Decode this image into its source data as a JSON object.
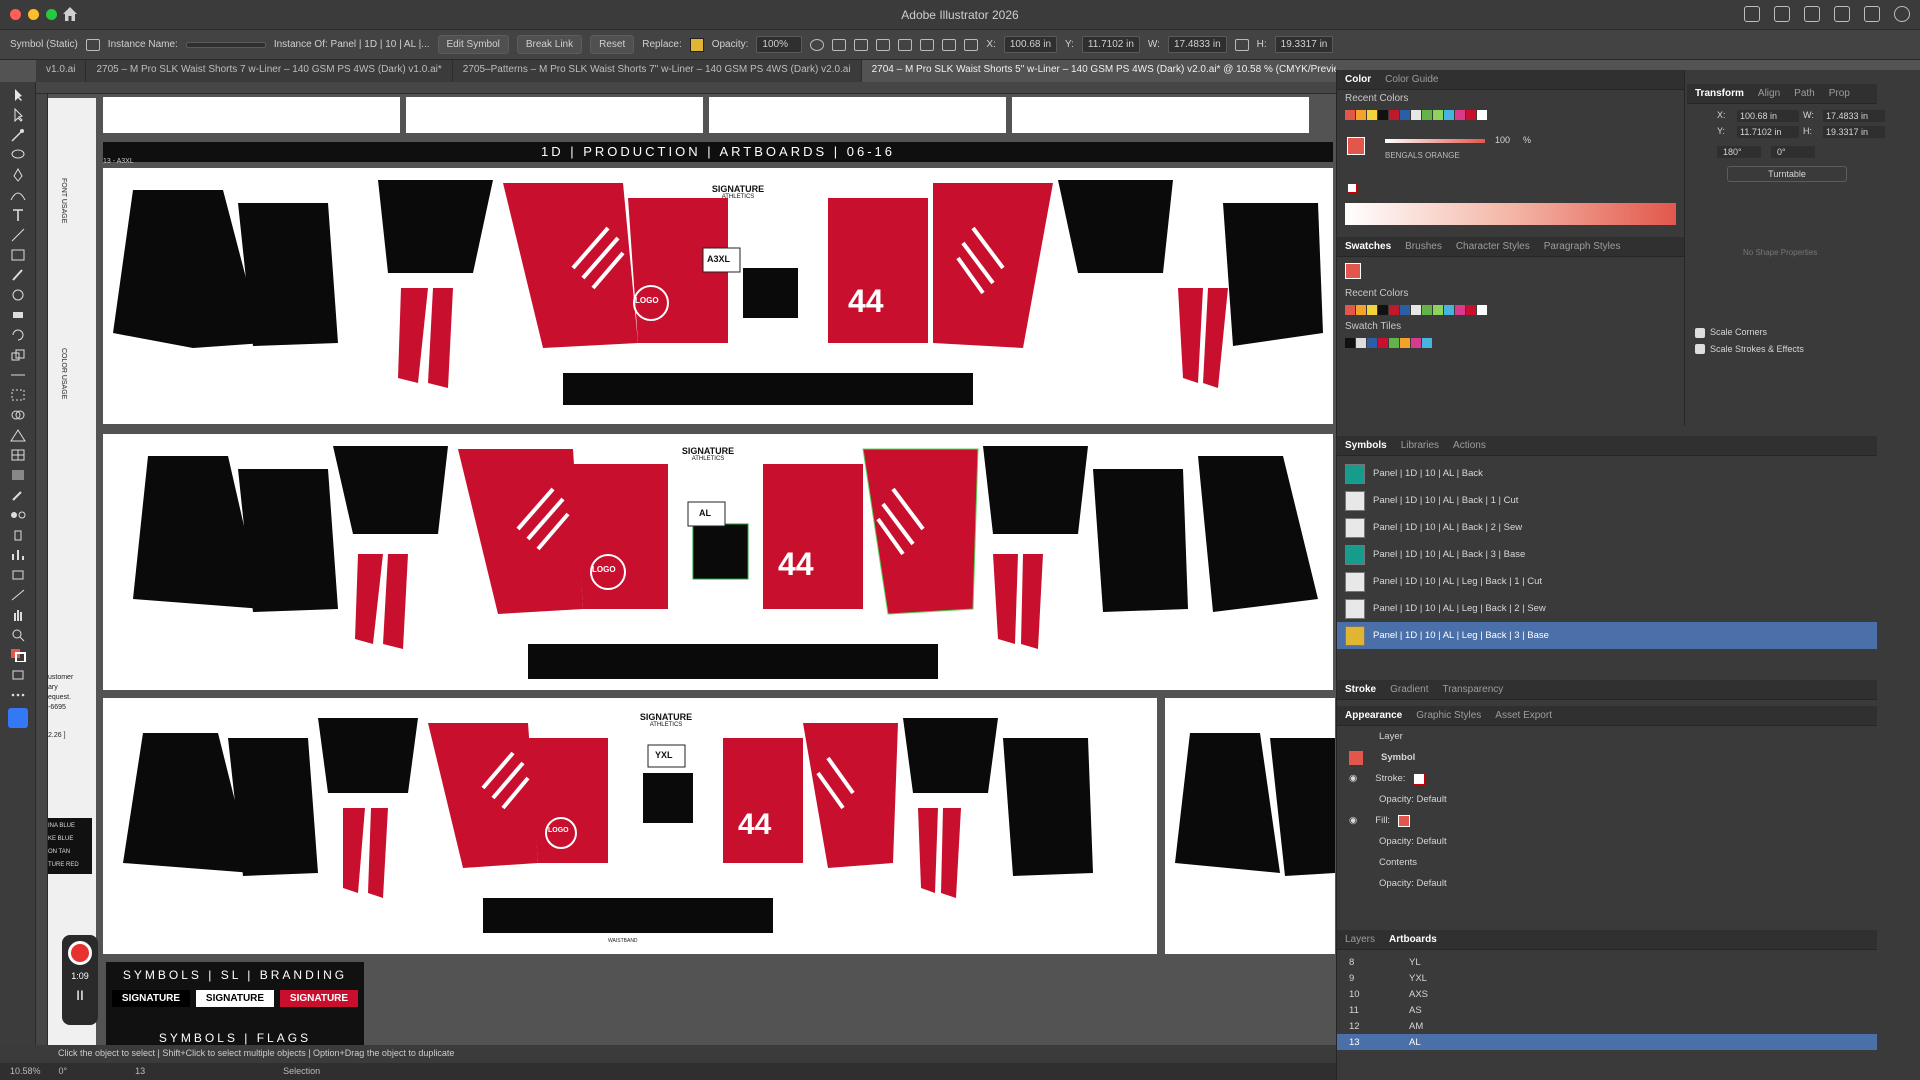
{
  "app": {
    "title": "Adobe Illustrator 2026"
  },
  "control": {
    "symbol_type": "Symbol (Static)",
    "instance_name_label": "Instance Name:",
    "instance_of": "Instance Of: Panel | 1D | 10 | AL |...",
    "edit_symbol": "Edit Symbol",
    "break_link": "Break Link",
    "reset": "Reset",
    "replace_label": "Replace:",
    "opacity_label": "Opacity:",
    "opacity_value": "100%",
    "x_label": "X:",
    "x_value": "100.68 in",
    "y_label": "Y:",
    "y_value": "11.7102 in",
    "w_label": "W:",
    "w_value": "17.4833 in",
    "h_label": "H:",
    "h_value": "19.3317 in"
  },
  "tabs": [
    {
      "label": "v1.0.ai"
    },
    {
      "label": "2705 – M Pro SLK Waist Shorts 7 w-Liner – 140 GSM PS 4WS (Dark) v1.0.ai*"
    },
    {
      "label": "2705–Patterns – M Pro SLK Waist Shorts 7\" w-Liner – 140 GSM PS 4WS (Dark) v2.0.ai"
    },
    {
      "label": "2704 – M Pro SLK Waist Shorts 5\" w-Liner – 140 GSM PS 4WS (Dark) v2.0.ai* @ 10.58 % (CMYK/Preview)"
    }
  ],
  "canvas": {
    "banner": "1D | PRODUCTION | ARTBOARDS | 06-16",
    "artboard_label": "13 - A3XL",
    "side_labels": [
      "FONT USAGE",
      "COLOR USAGE"
    ],
    "size_tags": [
      "A3XL",
      "AL",
      "YXL"
    ],
    "brand": "SIGNATURE",
    "brand_sub": "ATHLETICS",
    "number": "44",
    "logo": "LOGO",
    "waistband_label": "WAISTBAND",
    "bottom_header": "SYMBOLS | SL | BRANDING",
    "bottom_header2": "SYMBOLS | FLAGS",
    "brand_tiles": [
      "SIGNATURE",
      "SIGNATURE",
      "SIGNATURE"
    ]
  },
  "left_notes": [
    "ustomer",
    "ary",
    "equest.",
    "-6695",
    "2.26 ]",
    "INA BLUE",
    "KE BLUE",
    "ON TAN",
    "TURE RED"
  ],
  "recorder": {
    "time": "1:09",
    "pause": "II"
  },
  "status": {
    "hint": "Click the object to select | Shift+Click to select multiple objects | Option+Drag the object to duplicate"
  },
  "footer": {
    "zoom": "10.58%",
    "rotation": "0°",
    "artboard": "13",
    "tool": "Selection"
  },
  "color_panel": {
    "tabs": [
      "Color",
      "Color Guide"
    ],
    "recent_label": "Recent Colors",
    "t_value": "100",
    "t_unit": "%",
    "swatch_name": "BENGALS ORANGE",
    "recent_colors": [
      "#e2574c",
      "#f4a32a",
      "#f2d33b",
      "#111111",
      "#c2182b",
      "#2a5fa8",
      "#e6e6e6",
      "#63b34b",
      "#8fd35c",
      "#47b4e0",
      "#d93b8c",
      "#c8102e",
      "#ffffff"
    ]
  },
  "swatch_panel": {
    "tabs": [
      "Swatches",
      "Brushes",
      "Character Styles",
      "Paragraph Styles"
    ],
    "recent_label": "Recent Colors",
    "tiles_label": "Swatch Tiles"
  },
  "transform_panel": {
    "tabs": [
      "Transform",
      "Align",
      "Path",
      "Prop"
    ],
    "x_label": "X:",
    "x": "100.68 in",
    "y_label": "Y:",
    "y": "11.7102 in",
    "w_label": "W:",
    "w": "17.4833 in",
    "h_label": "H:",
    "h": "19.3317 in",
    "rotate": "180°",
    "shear": "0°",
    "turntable": "Turntable",
    "no_shape": "No Shape Properties",
    "scale_corners": "Scale Corners",
    "scale_strokes": "Scale Strokes & Effects"
  },
  "symbols_panel": {
    "tabs": [
      "Symbols",
      "Libraries",
      "Actions"
    ],
    "items": [
      {
        "label": "Panel | 1D | 10 | AL | Back",
        "color": "#169c8c"
      },
      {
        "label": "Panel | 1D | 10 | AL | Back | 1 | Cut",
        "color": "#e8e8e8"
      },
      {
        "label": "Panel | 1D | 10 | AL | Back | 2 | Sew",
        "color": "#e8e8e8"
      },
      {
        "label": "Panel | 1D | 10 | AL | Back | 3 | Base",
        "color": "#169c8c"
      },
      {
        "label": "Panel | 1D | 10 | AL | Leg | Back | 1 | Cut",
        "color": "#e8e8e8"
      },
      {
        "label": "Panel | 1D | 10 | AL | Leg | Back | 2 | Sew",
        "color": "#e8e8e8"
      },
      {
        "label": "Panel | 1D | 10 | AL | Leg | Back | 3 | Base",
        "color": "#e0b534"
      }
    ]
  },
  "appearance_panel": {
    "tabs": [
      "Stroke",
      "Gradient",
      "Transparency"
    ],
    "tabs2": [
      "Appearance",
      "Graphic Styles",
      "Asset Export"
    ],
    "layer": "Layer",
    "symbol": "Symbol",
    "stroke": "Stroke:",
    "opacity_default": "Opacity: Default",
    "fill": "Fill:",
    "contents": "Contents"
  },
  "artboards_panel": {
    "tabs": [
      "Layers",
      "Artboards"
    ],
    "rows": [
      {
        "num": "8",
        "name": "YL"
      },
      {
        "num": "9",
        "name": "YXL"
      },
      {
        "num": "10",
        "name": "AXS"
      },
      {
        "num": "11",
        "name": "AS"
      },
      {
        "num": "12",
        "name": "AM"
      },
      {
        "num": "13",
        "name": "AL"
      }
    ]
  }
}
